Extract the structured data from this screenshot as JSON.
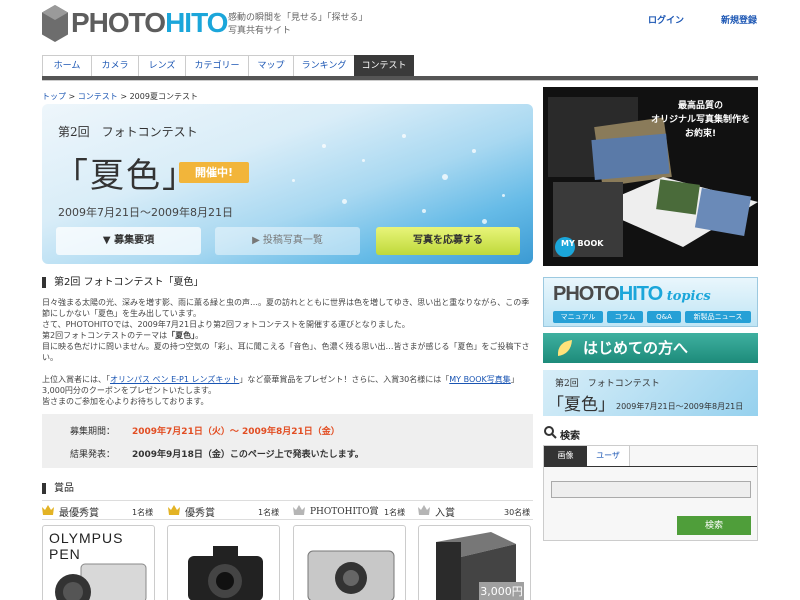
{
  "header": {
    "logo_part1": "PHOTO",
    "logo_part2": "HITO",
    "tagline": "感動の瞬間を「見せる」「探せる」写真共有サイト",
    "login": "ログイン",
    "signup": "新規登録"
  },
  "nav": {
    "tabs": [
      "ホーム",
      "カメラ",
      "レンズ",
      "カテゴリー",
      "マップ",
      "ランキング",
      "コンテスト"
    ],
    "active": "コンテスト"
  },
  "breadcrumb": {
    "items": [
      "トップ",
      "コンテスト",
      "2009夏コンテスト"
    ]
  },
  "hero": {
    "kicker": "第2回　フォトコンテスト",
    "title": "「夏色」",
    "badge": "開催中!",
    "dates": "2009年7月21日～2009年8月21日",
    "btn_guide": "▼ 募集要項",
    "btn_gallery": "▶ 投稿写真一覧",
    "btn_apply": "写真を応募する"
  },
  "intro": {
    "heading": "第2回 フォトコンテスト「夏色」",
    "p1": "日々強まる太陽の光、深みを増す影、雨に薫る緑と虫の声…。夏の訪れとともに世界は色を増してゆき、思い出と重なりながら、この季節にしかない「夏色」を生み出しています。",
    "p2": "さて、PHOTOHITOでは、2009年7月21日より第2回フォトコンテストを開催する運びとなりました。",
    "p3a": "第2回フォトコンテストのテーマは",
    "p3b": "「夏色」",
    "p3c": "。",
    "p4": "目に映る色だけに問いません。夏の持つ空気の「彩」、耳に聞こえる「音色」、色濃く残る思い出…皆さまが感じる「夏色」をご投稿下さい。",
    "p5a": "上位入賞者には、「",
    "p5_link1": "オリンパス ペン E-P1 レンズキット",
    "p5b": "」など豪華賞品をプレゼント！さらに、入賞30名様には「",
    "p5_link2": "MY BOOK写真集",
    "p5c": "」3,000円分のクーポンをプレゼントいたします。",
    "p6": "皆さまのご参加を心よりお待ちしております。"
  },
  "period": {
    "label1": "募集期間：",
    "value1": "2009年7月21日（火）～ 2009年8月21日（金）",
    "label2": "結果発表：",
    "value2": "2009年9月18日（金）このページ上で発表いたします。"
  },
  "prizes": {
    "heading": "賞品",
    "items": [
      {
        "name": "最優秀賞",
        "count": "1名様",
        "crown": "gold"
      },
      {
        "name": "優秀賞",
        "count": "1名様",
        "crown": "gold"
      },
      {
        "name": "PHOTOHITO賞",
        "count": "1名様",
        "crown": "silver"
      },
      {
        "name": "入賞",
        "count": "30名様",
        "crown": "silver"
      }
    ],
    "card1_text": "OLYMPUS PEN",
    "card4_price": "3,000円"
  },
  "sidebar": {
    "ad_text": "最高品質の\nオリジナル写真集制作を\nお約束!",
    "ad_brand": "MY BOOK",
    "topics_part1": "PHOTO",
    "topics_part2": "HITO",
    "topics_part3": "topics",
    "topics_chips": [
      "マニュアル",
      "コラム",
      "Q&A",
      "新製品ニュース"
    ],
    "first_time": "はじめての方へ",
    "summer_kicker": "第2回　フォトコンテスト",
    "summer_title": "「夏色」",
    "summer_dates": "2009年7月21日～2009年8月21日",
    "search_title": "検索",
    "search_tabs": [
      "画像",
      "ユーザ"
    ],
    "search_button": "検索"
  },
  "colors": {
    "brand_blue": "#1ba6da",
    "link": "#1a55b3",
    "accent_red": "#e24d22",
    "badge": "#f2b53a",
    "apply_green": "#bfd93a",
    "search_green": "#4f9e3a"
  }
}
